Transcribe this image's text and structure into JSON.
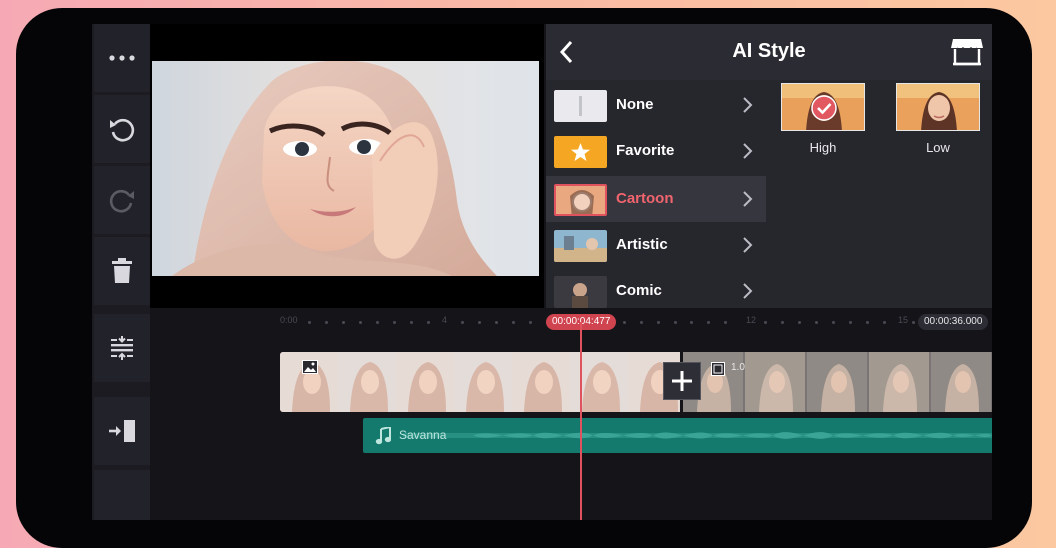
{
  "toolbar": {
    "items": [
      {
        "name": "more-icon"
      },
      {
        "name": "undo-icon"
      },
      {
        "name": "redo-icon"
      },
      {
        "name": "delete-icon"
      },
      {
        "name": "split-icon"
      },
      {
        "name": "export-icon"
      }
    ]
  },
  "panel": {
    "title": "AI Style",
    "styles": [
      {
        "label": "None"
      },
      {
        "label": "Favorite"
      },
      {
        "label": "Cartoon",
        "selected": true
      },
      {
        "label": "Artistic"
      },
      {
        "label": "Comic"
      }
    ],
    "intensity": [
      {
        "label": "High",
        "selected": true
      },
      {
        "label": "Low"
      }
    ]
  },
  "timeline": {
    "playhead_time": "00:00:04:477",
    "total_time": "00:00:36.000",
    "ruler_marks": [
      "0:00",
      "4",
      "8",
      "12",
      "15"
    ],
    "second_clip_duration": "1.0",
    "audio_title": "Savanna"
  },
  "colors": {
    "accent": "#e0525d",
    "audio_track": "#157a6e",
    "favorite": "#f5a623",
    "panel_bg": "#26262d"
  }
}
